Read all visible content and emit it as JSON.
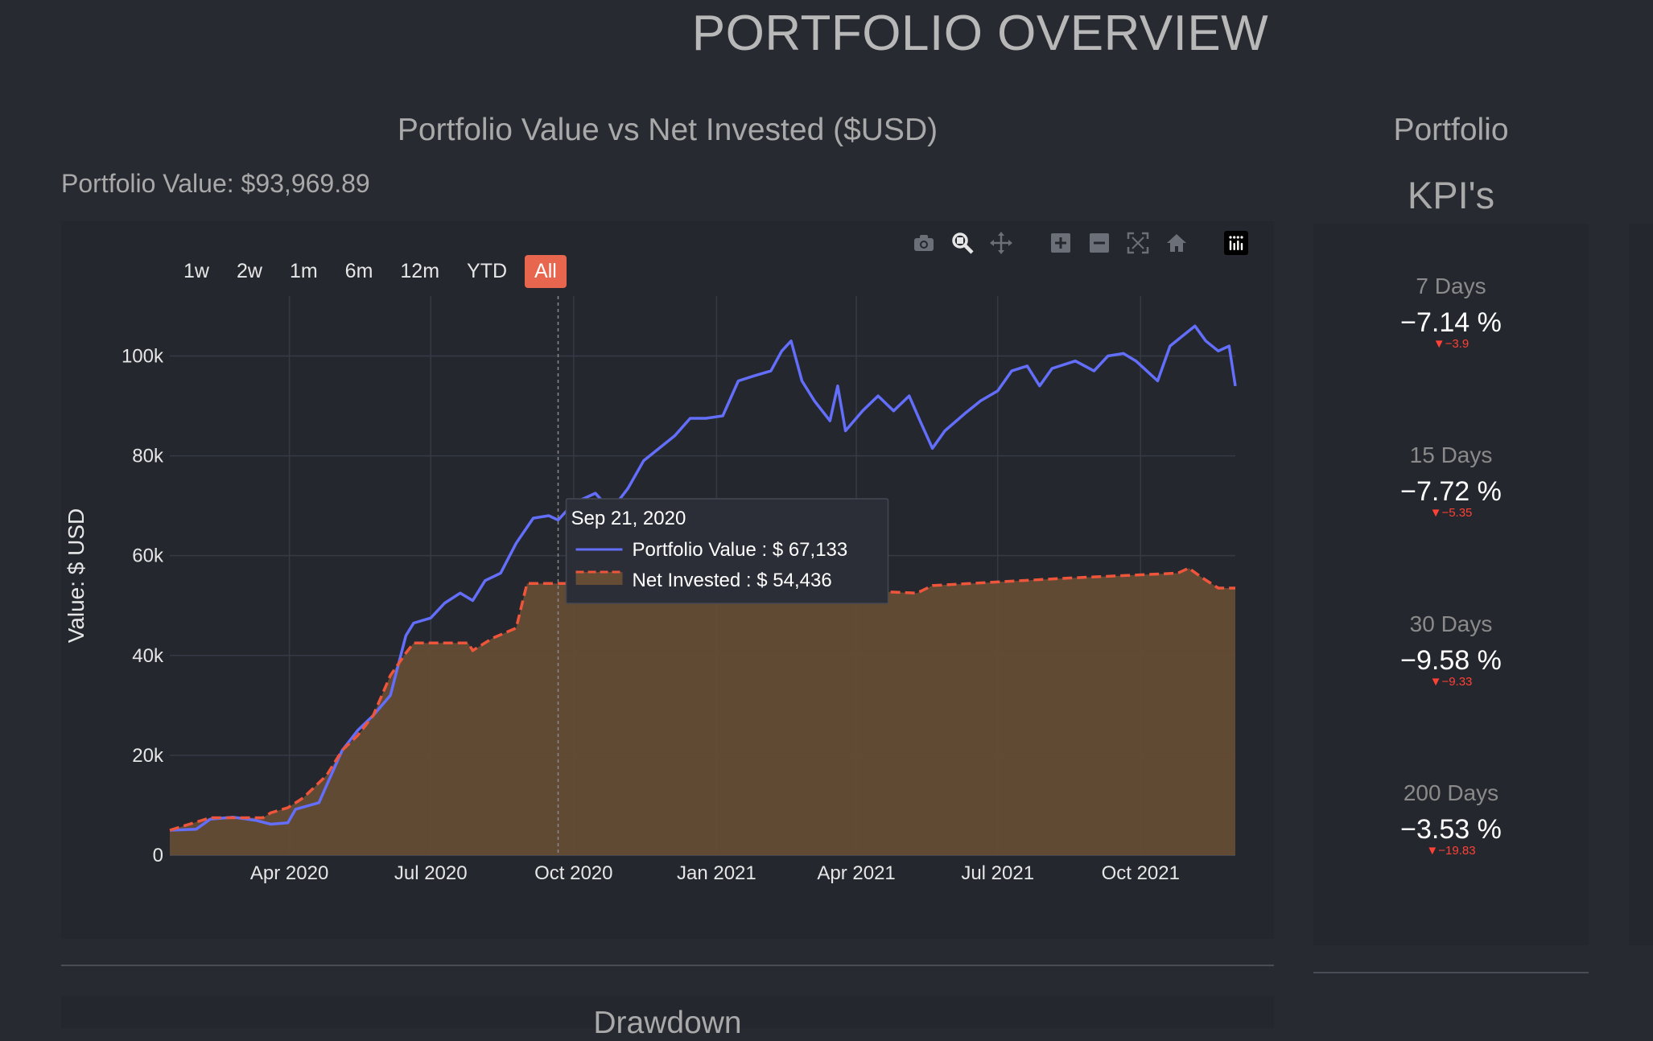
{
  "page_title": "PORTFOLIO OVERVIEW",
  "chart_title": "Portfolio Value vs Net Invested ($USD)",
  "portfolio_value_label": "Portfolio Value: $93,969.89",
  "range_selector": [
    {
      "label": "1w",
      "active": false
    },
    {
      "label": "2w",
      "active": false
    },
    {
      "label": "1m",
      "active": false
    },
    {
      "label": "6m",
      "active": false
    },
    {
      "label": "12m",
      "active": false
    },
    {
      "label": "YTD",
      "active": false
    },
    {
      "label": "All",
      "active": true
    }
  ],
  "modebar_icons": [
    "camera-icon",
    "zoom-icon",
    "pan-icon",
    "zoom-in-icon",
    "zoom-out-icon",
    "autoscale-icon",
    "reset-axes-icon",
    "plotly-logo-icon"
  ],
  "tooltip": {
    "date": "Sep 21, 2020",
    "line1": "Portfolio Value : $ 67,133",
    "line2": "Net Invested : $ 54,436"
  },
  "kpi_panel": {
    "title_line1": "Portfolio",
    "title_line2": "KPI's",
    "items": [
      {
        "label": "7 Days",
        "value": "−7.14 %",
        "delta": "▼−3.9"
      },
      {
        "label": "15 Days",
        "value": "−7.72 %",
        "delta": "▼−5.35"
      },
      {
        "label": "30 Days",
        "value": "−9.58 %",
        "delta": "▼−9.33"
      },
      {
        "label": "200 Days",
        "value": "−3.53 %",
        "delta": "▼−19.83"
      }
    ]
  },
  "bottom_section_title": "Drawdown",
  "colors": {
    "portfolio_line": "#636efa",
    "net_invested_line": "#ef553b",
    "net_invested_fill": "#654c35",
    "active_button": "#e8654e",
    "kpi_negative": "#ff4136"
  },
  "chart_data": {
    "type": "line",
    "title": "Portfolio Value vs Net Invested ($USD)",
    "ylabel": "Value: $ USD",
    "xlabel": "",
    "x_ticks": [
      "2020-04-01",
      "2020-07-01",
      "2020-10-01",
      "2021-01-01",
      "2021-04-01",
      "2021-07-01",
      "2021-10-01"
    ],
    "x_tick_labels": [
      "Apr 2020",
      "Jul 2020",
      "Oct 2020",
      "Jan 2021",
      "Apr 2021",
      "Jul 2021",
      "Oct 2021"
    ],
    "y_ticks": [
      0,
      20000,
      40000,
      60000,
      80000,
      100000
    ],
    "y_tick_labels": [
      "0",
      "20k",
      "40k",
      "60k",
      "80k",
      "100k"
    ],
    "xlim": [
      "2020-01-15",
      "2021-12-01"
    ],
    "ylim": [
      0,
      112000
    ],
    "grid": true,
    "hover_date": "2020-09-21",
    "series": [
      {
        "name": "Portfolio Value",
        "style": "solid",
        "points": [
          [
            "2020-01-15",
            5000
          ],
          [
            "2020-02-01",
            5200
          ],
          [
            "2020-02-10",
            7200
          ],
          [
            "2020-02-25",
            7600
          ],
          [
            "2020-03-10",
            7000
          ],
          [
            "2020-03-20",
            6200
          ],
          [
            "2020-03-31",
            6500
          ],
          [
            "2020-04-05",
            9200
          ],
          [
            "2020-04-20",
            10500
          ],
          [
            "2020-04-25",
            14000
          ],
          [
            "2020-05-05",
            21000
          ],
          [
            "2020-05-15",
            25000
          ],
          [
            "2020-05-25",
            28000
          ],
          [
            "2020-06-05",
            32000
          ],
          [
            "2020-06-10",
            38000
          ],
          [
            "2020-06-15",
            44000
          ],
          [
            "2020-06-20",
            46500
          ],
          [
            "2020-07-01",
            47500
          ],
          [
            "2020-07-10",
            50500
          ],
          [
            "2020-07-20",
            52500
          ],
          [
            "2020-07-28",
            51000
          ],
          [
            "2020-08-05",
            55000
          ],
          [
            "2020-08-15",
            56500
          ],
          [
            "2020-08-25",
            62500
          ],
          [
            "2020-09-05",
            67500
          ],
          [
            "2020-09-15",
            68000
          ],
          [
            "2020-09-21",
            67133
          ],
          [
            "2020-10-01",
            70500
          ],
          [
            "2020-10-15",
            72500
          ],
          [
            "2020-10-25",
            69000
          ],
          [
            "2020-11-05",
            73500
          ],
          [
            "2020-11-15",
            79000
          ],
          [
            "2020-11-25",
            81500
          ],
          [
            "2020-12-05",
            84000
          ],
          [
            "2020-12-15",
            87500
          ],
          [
            "2020-12-25",
            87500
          ],
          [
            "2021-01-05",
            88000
          ],
          [
            "2021-01-15",
            95000
          ],
          [
            "2021-01-25",
            96000
          ],
          [
            "2021-02-05",
            97000
          ],
          [
            "2021-02-12",
            101000
          ],
          [
            "2021-02-18",
            103000
          ],
          [
            "2021-02-25",
            95000
          ],
          [
            "2021-03-05",
            91000
          ],
          [
            "2021-03-15",
            87000
          ],
          [
            "2021-03-20",
            94000
          ],
          [
            "2021-03-25",
            85000
          ],
          [
            "2021-04-05",
            89000
          ],
          [
            "2021-04-15",
            92000
          ],
          [
            "2021-04-25",
            89000
          ],
          [
            "2021-05-05",
            92000
          ],
          [
            "2021-05-12",
            87000
          ],
          [
            "2021-05-20",
            81500
          ],
          [
            "2021-05-28",
            85000
          ],
          [
            "2021-06-10",
            88500
          ],
          [
            "2021-06-20",
            91000
          ],
          [
            "2021-07-01",
            93000
          ],
          [
            "2021-07-10",
            97000
          ],
          [
            "2021-07-20",
            98000
          ],
          [
            "2021-07-28",
            94000
          ],
          [
            "2021-08-05",
            97500
          ],
          [
            "2021-08-20",
            99000
          ],
          [
            "2021-09-01",
            97000
          ],
          [
            "2021-09-10",
            100000
          ],
          [
            "2021-09-20",
            100500
          ],
          [
            "2021-09-28",
            99000
          ],
          [
            "2021-10-05",
            97000
          ],
          [
            "2021-10-12",
            95000
          ],
          [
            "2021-10-20",
            102000
          ],
          [
            "2021-10-28",
            104000
          ],
          [
            "2021-11-05",
            106000
          ],
          [
            "2021-11-12",
            103000
          ],
          [
            "2021-11-20",
            101000
          ],
          [
            "2021-11-27",
            102000
          ],
          [
            "2021-12-01",
            93970
          ]
        ]
      },
      {
        "name": "Net Invested",
        "style": "dash",
        "points": [
          [
            "2020-01-15",
            5000
          ],
          [
            "2020-02-10",
            7500
          ],
          [
            "2020-03-15",
            7500
          ],
          [
            "2020-03-20",
            8500
          ],
          [
            "2020-03-31",
            9500
          ],
          [
            "2020-04-10",
            11500
          ],
          [
            "2020-04-25",
            16000
          ],
          [
            "2020-05-05",
            21000
          ],
          [
            "2020-05-15",
            24000
          ],
          [
            "2020-05-25",
            28000
          ],
          [
            "2020-06-05",
            36000
          ],
          [
            "2020-06-15",
            40500
          ],
          [
            "2020-06-20",
            42500
          ],
          [
            "2020-07-25",
            42500
          ],
          [
            "2020-07-28",
            41000
          ],
          [
            "2020-08-10",
            43500
          ],
          [
            "2020-08-25",
            45500
          ],
          [
            "2020-09-01",
            54436
          ],
          [
            "2020-12-31",
            54436
          ],
          [
            "2021-01-15",
            54000
          ],
          [
            "2021-05-10",
            52500
          ],
          [
            "2021-05-20",
            54000
          ],
          [
            "2021-08-15",
            55500
          ],
          [
            "2021-10-25",
            56500
          ],
          [
            "2021-11-01",
            57500
          ],
          [
            "2021-11-10",
            55500
          ],
          [
            "2021-11-20",
            53500
          ],
          [
            "2021-12-01",
            53500
          ]
        ]
      }
    ]
  }
}
